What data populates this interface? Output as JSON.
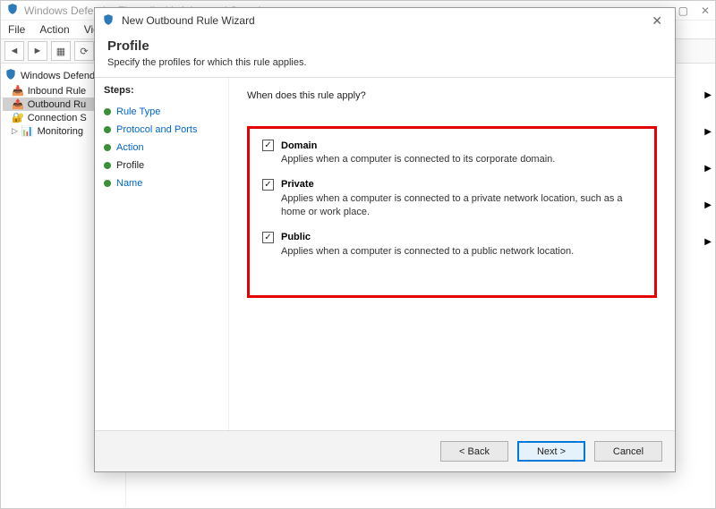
{
  "main_window": {
    "title": "Windows Defender Firewall with Advanced Security",
    "menu": {
      "file": "File",
      "action": "Action",
      "view": "View"
    },
    "tree": {
      "root": "Windows Defender",
      "inbound": "Inbound Rule",
      "outbound": "Outbound Ru",
      "connection": "Connection S",
      "monitoring": "Monitoring"
    }
  },
  "wizard": {
    "title": "New Outbound Rule Wizard",
    "header": "Profile",
    "subtitle": "Specify the profiles for which this rule applies.",
    "steps_label": "Steps:",
    "steps": {
      "rule_type": "Rule Type",
      "protocol": "Protocol and Ports",
      "action": "Action",
      "profile": "Profile",
      "name": "Name"
    },
    "prompt": "When does this rule apply?",
    "options": {
      "domain": {
        "label": "Domain",
        "desc": "Applies when a computer is connected to its corporate domain."
      },
      "private": {
        "label": "Private",
        "desc": "Applies when a computer is connected to a private network location, such as a home or work place."
      },
      "public": {
        "label": "Public",
        "desc": "Applies when a computer is connected to a public network location."
      }
    },
    "buttons": {
      "back": "< Back",
      "next": "Next >",
      "cancel": "Cancel"
    }
  }
}
